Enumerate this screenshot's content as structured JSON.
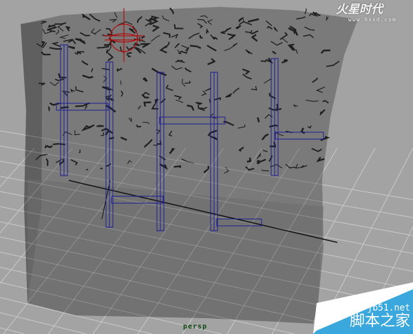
{
  "viewport": {
    "camera_label": "persp",
    "colors": {
      "background": "#a3a3a3",
      "wall": "#7a7a7a",
      "rig": "#1c1c9a",
      "locator": "#b01010",
      "grid": "#c8c8c8",
      "axis": "#111111"
    }
  },
  "watermarks": {
    "top_logo": "火星时代",
    "top_url": "www.hxsd.com",
    "bottom_url": "jb51.net",
    "bottom_name": "脚本之家"
  }
}
